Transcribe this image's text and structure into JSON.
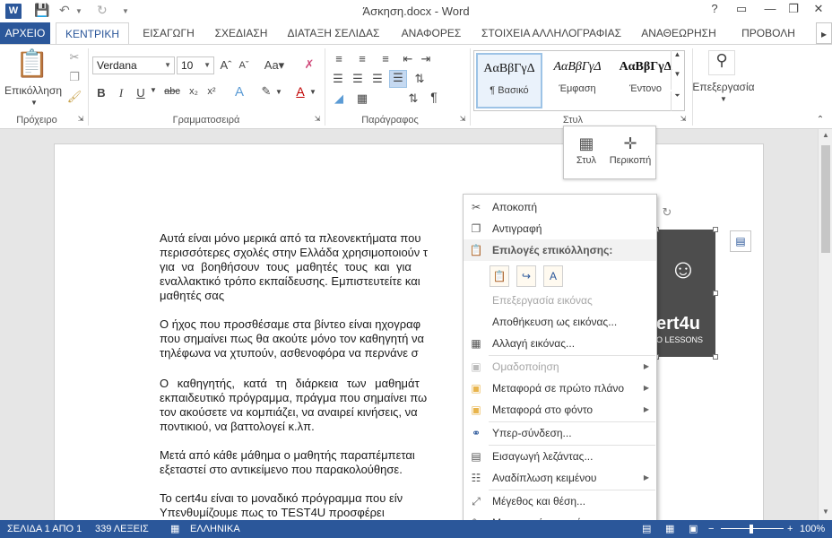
{
  "window": {
    "title": "Άσκηση.docx - Word",
    "app_icon": "W",
    "controls": [
      "?",
      "▭",
      "❐",
      "—",
      "✕"
    ]
  },
  "tabs": [
    {
      "label": "ΑΡΧΕΙΟ"
    },
    {
      "label": "ΚΕΝΤΡΙΚΗ"
    },
    {
      "label": "ΕΙΣΑΓΩΓΗ"
    },
    {
      "label": "ΣΧΕΔΙΑΣΗ"
    },
    {
      "label": "ΔΙΑΤΑΞΗ ΣΕΛΙΔΑΣ"
    },
    {
      "label": "ΑΝΑΦΟΡΕΣ"
    },
    {
      "label": "ΣΤΟΙΧΕΙΑ ΑΛΛΗΛΟΓΡΑΦΙΑΣ"
    },
    {
      "label": "ΑΝΑΘΕΩΡΗΣΗ"
    },
    {
      "label": "ΠΡΟΒΟΛΗ"
    }
  ],
  "ribbon": {
    "clipboard": {
      "paste_label": "Επικόλληση",
      "group_label": "Πρόχειρο"
    },
    "font": {
      "name": "Verdana",
      "size": "10",
      "group_label": "Γραμματοσειρά"
    },
    "paragraph": {
      "group_label": "Παράγραφος"
    },
    "styles": {
      "group_label": "Στυλ",
      "items": [
        {
          "preview": "AαΒβΓγΔ",
          "name": "¶ Βασικό"
        },
        {
          "preview": "AαΒβΓγΔ",
          "name": "Έμφαση"
        },
        {
          "preview": "AαΒβΓγΔ",
          "name": "Έντονο"
        }
      ]
    },
    "editing": {
      "label": "Επεξεργασία"
    }
  },
  "document": {
    "paragraphs": [
      "Αυτά είναι μόνο μερικά από τα πλεονεκτήματα που",
      "περισσότερες σχολές στην Ελλάδα χρησιμοποιούν τ",
      "για να βοηθήσουν τους μαθητές τους και για",
      "εναλλακτικό τρόπο εκπαίδευσης. Εμπιστευτείτε και",
      "μαθητές σας",
      "Ο ήχος που προσθέσαμε στα βίντεο είναι ηχογραφ",
      "που σημαίνει πως θα ακούτε μόνο τον καθηγητή να",
      "τηλέφωνα να χτυπούν, ασθενοφόρα να περνάνε σ",
      "Ο καθηγητής, κατά τη διάρκεια των μαθημάτ",
      "εκπαιδευτικό πρόγραμμα, πράγμα που σημαίνει πω",
      "τον ακούσετε να κομπιάζει, να αναιρεί κινήσεις, να",
      "ποντικιού, να βαττολογεί  κ.λπ.",
      "Μετά από κάθε μάθημα ο μαθητής παραπέμπεται",
      "εξεταστεί στο αντικείμενο που παρακολούθησε.",
      "Το cert4u είναι το μοναδικό πρόγραμμα που είν",
      "Υπενθυμίζουμε  πως  το  TEST4U  προσφέρει"
    ],
    "picture_text": {
      "line1": "ert4u",
      "line2": "O LESSONS"
    }
  },
  "mini_toolbar": {
    "style_label": "Στυλ",
    "crop_label": "Περικοπή"
  },
  "context_menu": {
    "items": [
      {
        "label": "Αποκοπή",
        "icon": "scissors-icon",
        "disabled": false,
        "submenu": false
      },
      {
        "label": "Αντιγραφή",
        "icon": "copy-icon",
        "disabled": false,
        "submenu": false
      },
      {
        "label": "Επιλογές επικόλλησης:",
        "icon": "paste-options-icon",
        "header": true
      },
      {
        "label": "Επεξεργασία εικόνας",
        "icon": "",
        "disabled": true,
        "submenu": false
      },
      {
        "label": "Αποθήκευση ως εικόνας...",
        "icon": "",
        "disabled": false,
        "submenu": false
      },
      {
        "label": "Αλλαγή εικόνας...",
        "icon": "change-picture-icon",
        "disabled": false,
        "submenu": false
      },
      {
        "label": "Ομαδοποίηση",
        "icon": "group-icon",
        "disabled": true,
        "submenu": true
      },
      {
        "label": "Μεταφορά σε πρώτο πλάνο",
        "icon": "bring-forward-icon",
        "disabled": false,
        "submenu": true
      },
      {
        "label": "Μεταφορά στο φόντο",
        "icon": "send-backward-icon",
        "disabled": false,
        "submenu": true
      },
      {
        "label": "Υπερ-σύνδεση...",
        "icon": "hyperlink-icon",
        "disabled": false,
        "submenu": false
      },
      {
        "label": "Εισαγωγή λεζάντας...",
        "icon": "caption-icon",
        "disabled": false,
        "submenu": false
      },
      {
        "label": "Αναδίπλωση κειμένου",
        "icon": "wrap-text-icon",
        "disabled": false,
        "submenu": true
      },
      {
        "label": "Μέγεθος και θέση...",
        "icon": "size-position-icon",
        "disabled": false,
        "submenu": false
      },
      {
        "label": "Μορφοποίηση εικόνας...",
        "icon": "format-picture-icon",
        "disabled": false,
        "submenu": false
      }
    ]
  },
  "status": {
    "page": "ΣΕΛΙΔΑ 1 ΑΠΟ 1",
    "words": "339 ΛΕΞΕΙΣ",
    "language": "ΕΛΛΗΝΙΚΑ",
    "zoom": "100%"
  },
  "colors": {
    "accent": "#2b579a",
    "statusbar": "#2b579a"
  }
}
